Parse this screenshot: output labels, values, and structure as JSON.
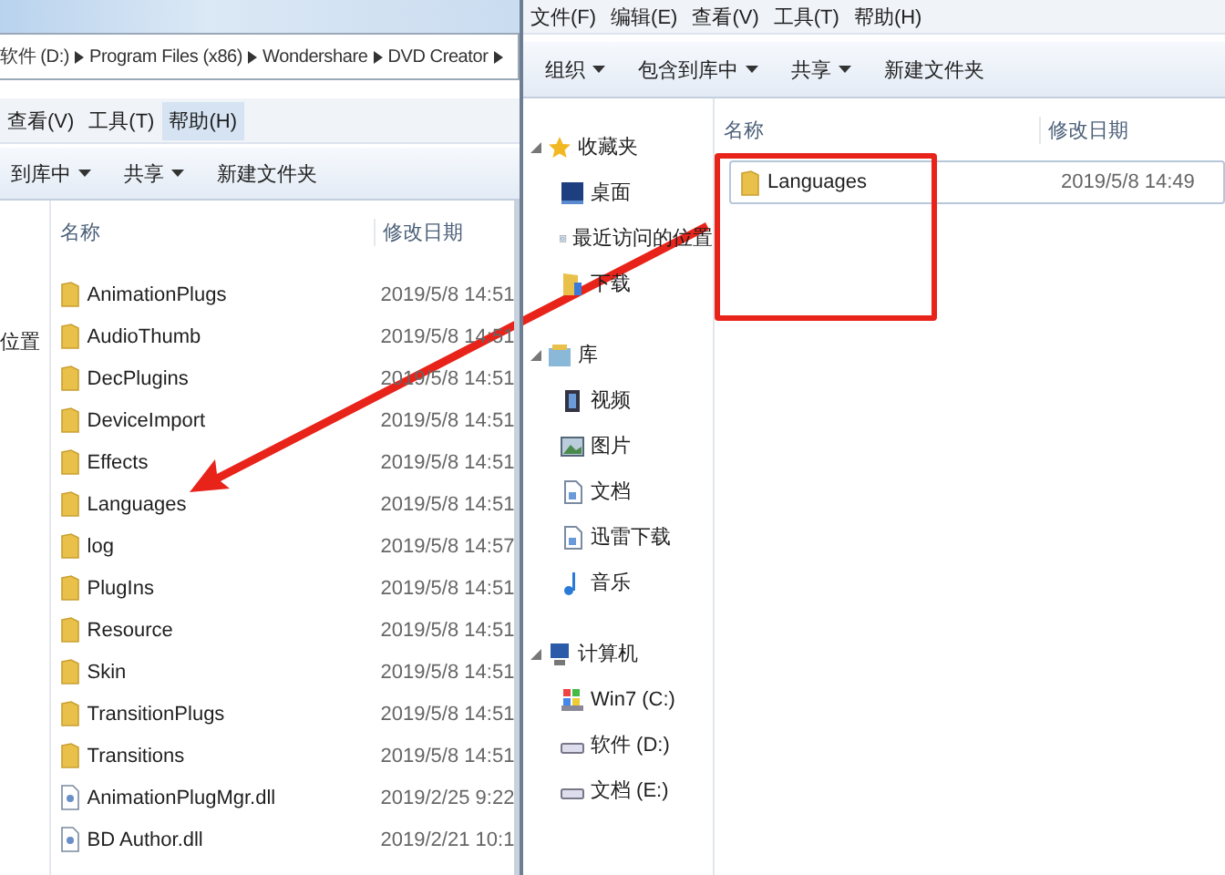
{
  "left_window": {
    "breadcrumb": [
      "软件 (D:)",
      "Program Files (x86)",
      "Wondershare",
      "DVD Creator"
    ],
    "menu": [
      {
        "label": "查看(V)",
        "selected": false
      },
      {
        "label": "工具(T)",
        "selected": false
      },
      {
        "label": "帮助(H)",
        "selected": true
      }
    ],
    "toolbar": [
      {
        "label": "到库中",
        "dropdown": true
      },
      {
        "label": "共享",
        "dropdown": true
      },
      {
        "label": "新建文件夹",
        "dropdown": false
      }
    ],
    "nav": [
      "位置"
    ],
    "columns": [
      "名称",
      "修改日期"
    ],
    "rows": [
      {
        "kind": "folder",
        "name": "AnimationPlugs",
        "modified": "2019/5/8 14:51"
      },
      {
        "kind": "folder",
        "name": "AudioThumb",
        "modified": "2019/5/8 14:51"
      },
      {
        "kind": "folder",
        "name": "DecPlugins",
        "modified": "2019/5/8 14:51"
      },
      {
        "kind": "folder",
        "name": "DeviceImport",
        "modified": "2019/5/8 14:51"
      },
      {
        "kind": "folder",
        "name": "Effects",
        "modified": "2019/5/8 14:51"
      },
      {
        "kind": "folder",
        "name": "Languages",
        "modified": "2019/5/8 14:51"
      },
      {
        "kind": "folder",
        "name": "log",
        "modified": "2019/5/8 14:57"
      },
      {
        "kind": "folder",
        "name": "PlugIns",
        "modified": "2019/5/8 14:51"
      },
      {
        "kind": "folder",
        "name": "Resource",
        "modified": "2019/5/8 14:51"
      },
      {
        "kind": "folder",
        "name": "Skin",
        "modified": "2019/5/8 14:51"
      },
      {
        "kind": "folder",
        "name": "TransitionPlugs",
        "modified": "2019/5/8 14:51"
      },
      {
        "kind": "folder",
        "name": "Transitions",
        "modified": "2019/5/8 14:51"
      },
      {
        "kind": "dll",
        "name": "AnimationPlugMgr.dll",
        "modified": "2019/2/25 9:22"
      },
      {
        "kind": "dll",
        "name": "BD Author.dll",
        "modified": "2019/2/21 10:1"
      }
    ]
  },
  "right_window": {
    "menu": [
      {
        "label": "文件(F)",
        "selected": false
      },
      {
        "label": "编辑(E)",
        "selected": false
      },
      {
        "label": "查看(V)",
        "selected": false
      },
      {
        "label": "工具(T)",
        "selected": false
      },
      {
        "label": "帮助(H)",
        "selected": false
      }
    ],
    "toolbar": [
      {
        "label": "组织",
        "dropdown": true
      },
      {
        "label": "包含到库中",
        "dropdown": true
      },
      {
        "label": "共享",
        "dropdown": true
      },
      {
        "label": "新建文件夹",
        "dropdown": false
      }
    ],
    "nav": [
      {
        "label": "收藏夹",
        "kind": "star",
        "expanded": true,
        "children": [
          {
            "label": "桌面",
            "kind": "desktop"
          },
          {
            "label": "最近访问的位置",
            "kind": "recent"
          },
          {
            "label": "下载",
            "kind": "downloads"
          }
        ]
      },
      {
        "label": "库",
        "kind": "library",
        "expanded": true,
        "children": [
          {
            "label": "视频",
            "kind": "video"
          },
          {
            "label": "图片",
            "kind": "pictures"
          },
          {
            "label": "文档",
            "kind": "document"
          },
          {
            "label": "迅雷下载",
            "kind": "document"
          },
          {
            "label": "音乐",
            "kind": "music"
          }
        ]
      },
      {
        "label": "计算机",
        "kind": "computer",
        "expanded": true,
        "children": [
          {
            "label": "Win7 (C:)",
            "kind": "system-drive"
          },
          {
            "label": "软件 (D:)",
            "kind": "drive"
          },
          {
            "label": "文档 (E:)",
            "kind": "drive"
          }
        ]
      }
    ],
    "columns": [
      "名称",
      "修改日期"
    ],
    "rows": [
      {
        "kind": "folder",
        "name": "Languages",
        "modified": "2019/5/8 14:49",
        "selected": true
      }
    ]
  }
}
